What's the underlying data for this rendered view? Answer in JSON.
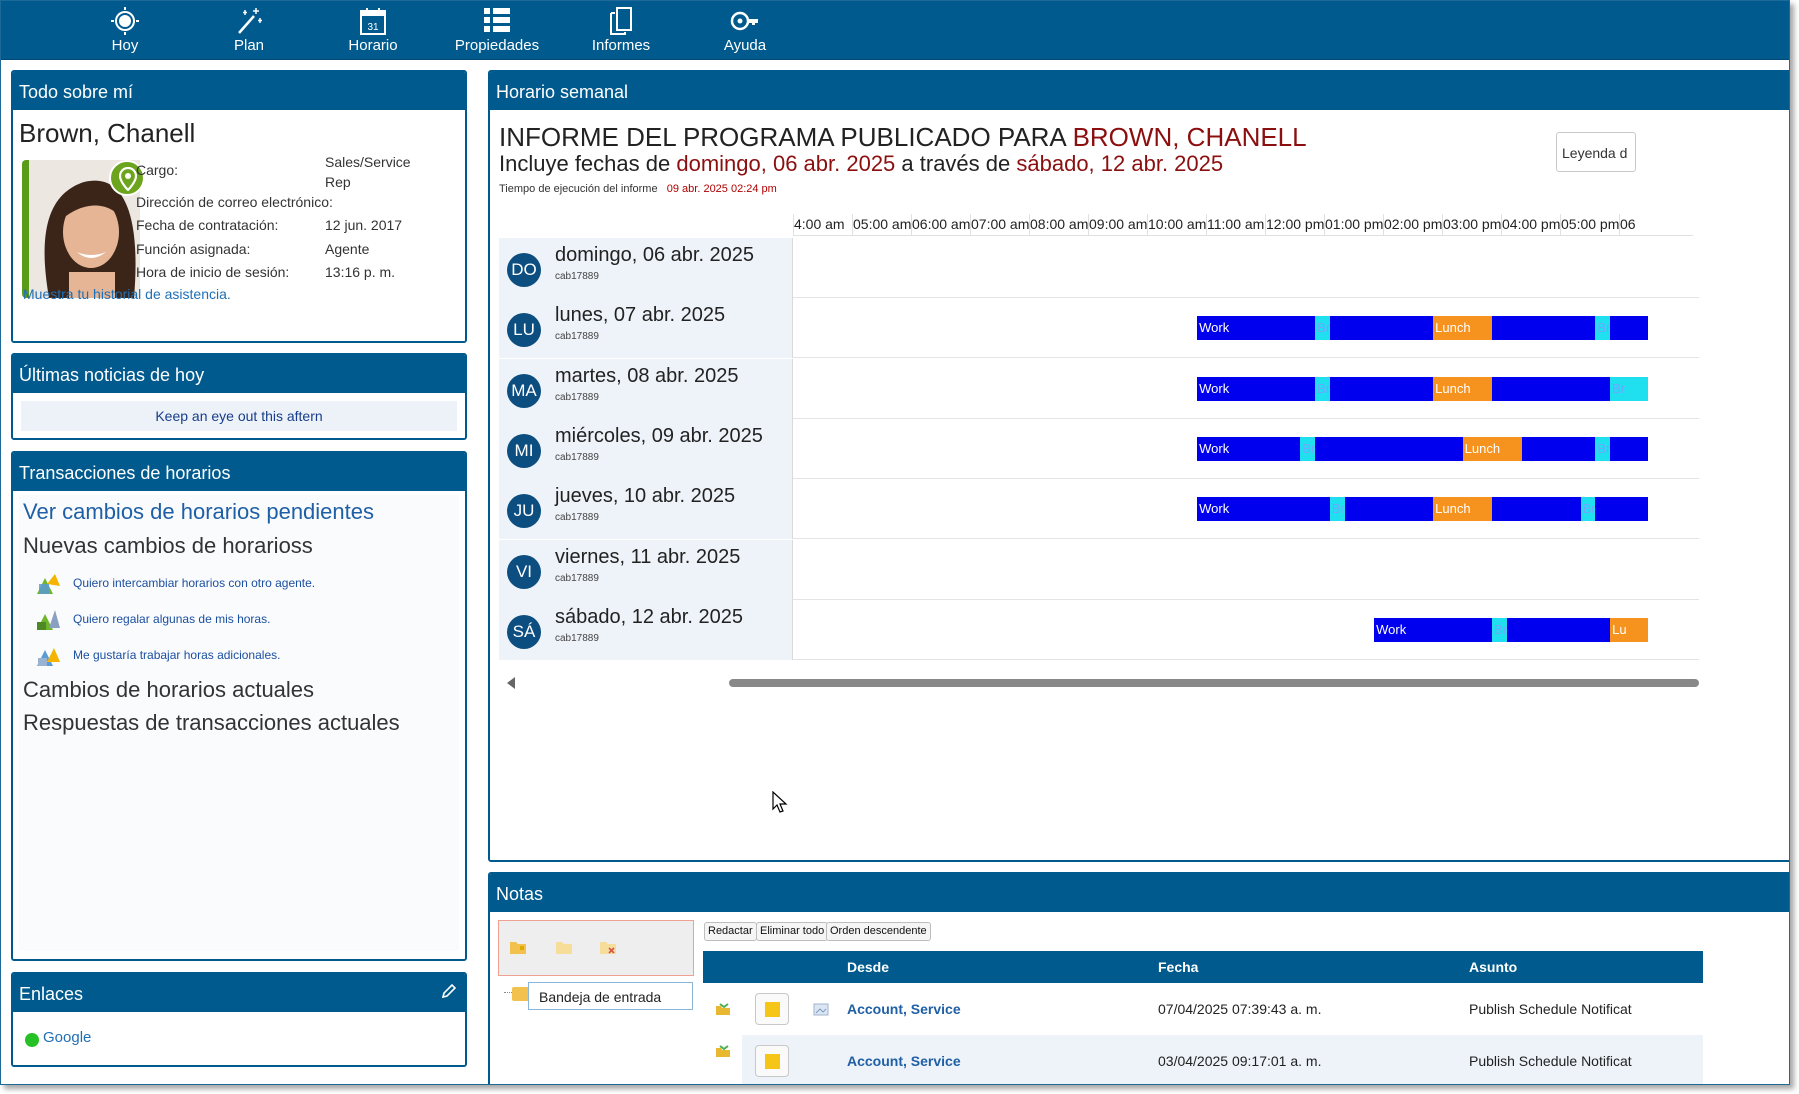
{
  "nav": {
    "items": [
      {
        "label": "Hoy",
        "icon": "sun-icon"
      },
      {
        "label": "Plan",
        "icon": "magic-wand-icon"
      },
      {
        "label": "Horario",
        "icon": "calendar-icon",
        "calendar_day": "31"
      },
      {
        "label": "Propiedades",
        "icon": "list-icon"
      },
      {
        "label": "Informes",
        "icon": "documents-icon"
      },
      {
        "label": "Ayuda",
        "icon": "help-key-icon"
      }
    ]
  },
  "about": {
    "title": "Todo sobre mí",
    "name": "Brown, Chanell",
    "fields": [
      {
        "label": "Cargo:",
        "value": "Sales/Service Rep"
      },
      {
        "label": "Dirección de correo electrónico:",
        "value": ""
      },
      {
        "label": "Fecha de contratación:",
        "value": "12 jun. 2017"
      },
      {
        "label": "Función asignada:",
        "value": "Agente"
      },
      {
        "label": "Hora de inicio de sesión:",
        "value": "13:16 p. m."
      }
    ],
    "history_link": "Muestra tu historial de asistencia."
  },
  "news": {
    "title": "Últimas noticias de hoy",
    "ticker": "Keep an eye out this aftern"
  },
  "transactions": {
    "title": "Transacciones de horarios",
    "pending_link": "Ver cambios de horarios pendientes",
    "new_heading": "Nuevas cambios de horarioss",
    "items": [
      "Quiero intercambiar horarios con otro agente.",
      "Quiero regalar algunas de mis horas.",
      "Me gustaría trabajar horas adicionales."
    ],
    "current_changes": "Cambios de horarios actuales",
    "current_responses": "Respuestas de transacciones actuales"
  },
  "links": {
    "title": "Enlaces",
    "items": [
      {
        "label": "Google",
        "status_color": "#25c125"
      }
    ]
  },
  "schedule": {
    "panel_title": "Horario semanal",
    "title_prefix": "INFORME DEL PROGRAMA PUBLICADO PARA ",
    "title_name": "BROWN, CHANELL",
    "sub_prefix": "Incluye fechas de ",
    "sub_start": "domingo, 06 abr. 2025",
    "sub_mid": " a través de ",
    "sub_end": "sábado, 12 abr. 2025",
    "run_label": "Tiempo de ejecución del informe",
    "run_value": "09 abr. 2025 02:24 pm",
    "legend_label": "Leyenda d",
    "time_ticks": [
      "4:00 am",
      "05:00 am",
      "06:00 am",
      "07:00 am",
      "08:00 am",
      "09:00 am",
      "10:00 am",
      "11:00 am",
      "12:00 pm",
      "01:00 pm",
      "02:00 pm",
      "03:00 pm",
      "04:00 pm",
      "05:00 pm",
      "06"
    ],
    "axis_start_hour": 4,
    "days": [
      {
        "badge": "DO",
        "name": "domingo, 06 abr. 2025",
        "code": "cab17889",
        "segments": []
      },
      {
        "badge": "LU",
        "name": "lunes, 07 abr. 2025",
        "code": "cab17889",
        "segments": [
          {
            "type": "work",
            "label": "Work",
            "start": 10.85,
            "end": 12.85
          },
          {
            "type": "break",
            "label": "Br",
            "start": 12.85,
            "end": 13.1
          },
          {
            "type": "work",
            "label": "",
            "start": 13.1,
            "end": 14.85
          },
          {
            "type": "lunch",
            "label": "Lunch",
            "start": 14.85,
            "end": 15.85
          },
          {
            "type": "work",
            "label": "",
            "start": 15.85,
            "end": 17.6
          },
          {
            "type": "break",
            "label": "Br",
            "start": 17.6,
            "end": 17.85
          },
          {
            "type": "work",
            "label": "",
            "start": 17.85,
            "end": 18.5
          }
        ]
      },
      {
        "badge": "MA",
        "name": "martes, 08 abr. 2025",
        "code": "cab17889",
        "segments": [
          {
            "type": "work",
            "label": "Work",
            "start": 10.85,
            "end": 12.85
          },
          {
            "type": "break",
            "label": "Br",
            "start": 12.85,
            "end": 13.1
          },
          {
            "type": "work",
            "label": "",
            "start": 13.1,
            "end": 14.85
          },
          {
            "type": "lunch",
            "label": "Lunch",
            "start": 14.85,
            "end": 15.85
          },
          {
            "type": "work",
            "label": "",
            "start": 15.85,
            "end": 17.85
          },
          {
            "type": "break",
            "label": "Br",
            "start": 17.85,
            "end": 18.5
          }
        ]
      },
      {
        "badge": "MI",
        "name": "miércoles, 09 abr. 2025",
        "code": "cab17889",
        "segments": [
          {
            "type": "work",
            "label": "Work",
            "start": 10.85,
            "end": 12.6
          },
          {
            "type": "break",
            "label": "Br",
            "start": 12.6,
            "end": 12.85
          },
          {
            "type": "work",
            "label": "",
            "start": 12.85,
            "end": 15.35
          },
          {
            "type": "lunch",
            "label": "Lunch",
            "start": 15.35,
            "end": 16.35
          },
          {
            "type": "work",
            "label": "",
            "start": 16.35,
            "end": 17.6
          },
          {
            "type": "break",
            "label": "Br",
            "start": 17.6,
            "end": 17.85
          },
          {
            "type": "work",
            "label": "",
            "start": 17.85,
            "end": 18.5
          }
        ]
      },
      {
        "badge": "JU",
        "name": "jueves, 10 abr. 2025",
        "code": "cab17889",
        "segments": [
          {
            "type": "work",
            "label": "Work",
            "start": 10.85,
            "end": 13.1
          },
          {
            "type": "break",
            "label": "Br",
            "start": 13.1,
            "end": 13.35
          },
          {
            "type": "work",
            "label": "",
            "start": 13.35,
            "end": 14.85
          },
          {
            "type": "lunch",
            "label": "Lunch",
            "start": 14.85,
            "end": 15.85
          },
          {
            "type": "work",
            "label": "",
            "start": 15.85,
            "end": 17.35
          },
          {
            "type": "break",
            "label": "Br",
            "start": 17.35,
            "end": 17.6
          },
          {
            "type": "work",
            "label": "",
            "start": 17.6,
            "end": 18.5
          }
        ]
      },
      {
        "badge": "VI",
        "name": "viernes, 11 abr. 2025",
        "code": "cab17889",
        "segments": []
      },
      {
        "badge": "SÁ",
        "name": "sábado, 12 abr. 2025",
        "code": "cab17889",
        "segments": [
          {
            "type": "work",
            "label": "Work",
            "start": 13.85,
            "end": 15.85
          },
          {
            "type": "break",
            "label": "Br",
            "start": 15.85,
            "end": 16.1
          },
          {
            "type": "work",
            "label": "",
            "start": 16.1,
            "end": 17.85
          },
          {
            "type": "lunch",
            "label": "Lu",
            "start": 17.85,
            "end": 18.5
          }
        ]
      }
    ]
  },
  "notes": {
    "title": "Notas",
    "folder": "Bandeja de entrada",
    "buttons": {
      "compose": "Redactar",
      "delete_all": "Eliminar todo",
      "sort": "Orden descendente"
    },
    "columns": {
      "from": "Desde",
      "date": "Fecha",
      "subject": "Asunto"
    },
    "rows": [
      {
        "from": "Account, Service",
        "date": "07/04/2025 07:39:43 a. m.",
        "subject": "Publish Schedule Notificat"
      },
      {
        "from": "Account, Service",
        "date": "03/04/2025 09:17:01 a. m.",
        "subject": "Publish Schedule Notificat"
      }
    ]
  },
  "colors": {
    "brand": "#005a8d",
    "work": "#0000ee",
    "break": "#20e0f0",
    "lunch": "#f6921e",
    "accent_red": "#8b0f0f"
  }
}
